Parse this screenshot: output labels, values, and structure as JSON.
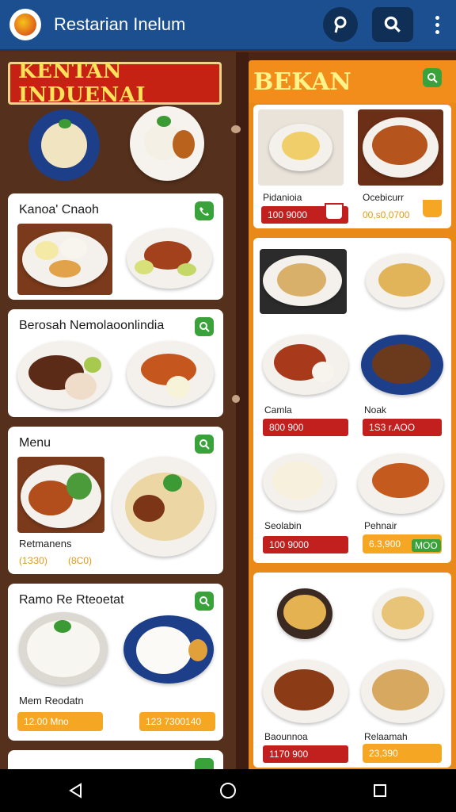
{
  "app": {
    "title": "Restarian Inelum"
  },
  "topbar": {
    "icons": [
      "app-logo",
      "pin-icon",
      "search-icon",
      "more-vert-icon"
    ]
  },
  "left": {
    "banner": "KENTAN INDUENAI",
    "cards": [
      {
        "title": "Kanoa' Cnaoh"
      },
      {
        "title": "Berosah Nemolaoonlindia"
      },
      {
        "title": "Menu",
        "caption": "Retmanens",
        "prices": [
          "(1ЗЗ0)",
          "(8C0)"
        ]
      },
      {
        "title": "Ramo Re Rteoetat",
        "caption": "Mem Reodatn",
        "prices": [
          "12.00 Mno",
          "123 7300140"
        ]
      }
    ]
  },
  "right": {
    "banner": "BEKAN",
    "card1": {
      "items": [
        {
          "name": "Pidanioia",
          "price": "100 9000"
        },
        {
          "name": "Ocebicurr",
          "price": "00,ѕ0,0700"
        }
      ]
    },
    "card2": {
      "items": [
        {
          "name": "Camla",
          "price": "800 900"
        },
        {
          "name": "Noak",
          "price": "1S3 r.AOO"
        },
        {
          "name": "Seolabin",
          "price": "100 9000"
        },
        {
          "name": "Pehnair",
          "price": "6.3,900",
          "badge": "MOO"
        }
      ]
    },
    "card3": {
      "items": [
        {
          "name": "Baounnoa",
          "price": "1170 900"
        },
        {
          "name": "Relaamah",
          "price": "23,390"
        }
      ]
    }
  },
  "colors": {
    "topbar": "#1c4f8f",
    "banner_left": "#c52214",
    "banner_right": "#f28c1a",
    "price_red": "#c21f1f",
    "price_orange": "#f5a623",
    "check": "#3aa23a"
  }
}
